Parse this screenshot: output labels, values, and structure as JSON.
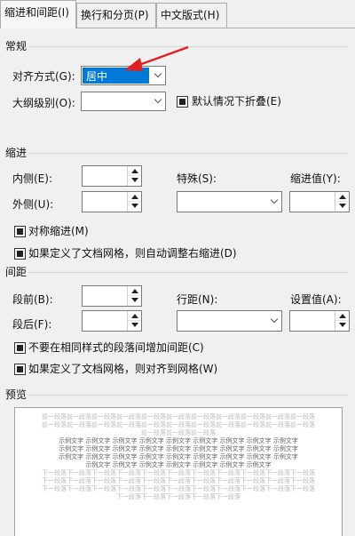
{
  "tabs": [
    {
      "label": "缩进和间距(I)",
      "active": true
    },
    {
      "label": "换行和分页(P)",
      "active": false
    },
    {
      "label": "中文版式(H)",
      "active": false
    }
  ],
  "general": {
    "title": "常规",
    "alignment_label": "对齐方式(G):",
    "alignment_value": "居中",
    "outline_label": "大纲级别(O):",
    "outline_value": "",
    "collapse_label": "默认情况下折叠(E)"
  },
  "indent": {
    "title": "缩进",
    "inside_label": "内侧(E):",
    "inside_value": "",
    "outside_label": "外侧(U):",
    "outside_value": "",
    "special_label": "特殊(S):",
    "special_value": "",
    "by_label": "缩进值(Y):",
    "by_value": "",
    "mirror_label": "对称缩进(M)",
    "grid_label": "如果定义了文档网格，则自动调整右缩进(D)"
  },
  "spacing": {
    "title": "间距",
    "before_label": "段前(B):",
    "before_value": "",
    "after_label": "段后(F):",
    "after_value": "",
    "line_label": "行距(N):",
    "line_value": "",
    "at_label": "设置值(A):",
    "at_value": "",
    "no_space_label": "不要在相同样式的段落间增加间距(C)",
    "snap_label": "如果定义了文档网格，则对齐到网格(W)"
  },
  "preview": {
    "title": "预览",
    "lines": [
      {
        "text": "前一段落前一段落前一段落前一段落前一段落前一段落前一段落前一段落前一段落前一段落前一段落",
        "tone": "grey"
      },
      {
        "text": "前一段落前一段落前一段落前一段落前一段落前一段落前一段落前一段落前一段落前一段落前一段落",
        "tone": "grey"
      },
      {
        "text": "前一段落前一段落前一段落",
        "tone": "grey"
      },
      {
        "text": "示例文字  示例文字  示例文字  示例文字  示例文字  示例文字  示例文字  示例文字  示例文字",
        "tone": "dark"
      },
      {
        "text": "示例文字  示例文字  示例文字  示例文字  示例文字  示例文字  示例文字  示例文字  示例文字",
        "tone": "dark"
      },
      {
        "text": "示例文字  示例文字  示例文字  示例文字  示例文字  示例文字  示例文字  示例文字  示例文字",
        "tone": "dark"
      },
      {
        "text": "示例文字  示例文字  示例文字  示例文字  示例文字  示例文字  示例文字",
        "tone": "dark"
      },
      {
        "text": "下一段落下一段落下一段落下一段落下一段落下一段落下一段落下一段落下一段落下一段落下一段落",
        "tone": "grey"
      },
      {
        "text": "下一段落下一段落下一段落下一段落下一段落下一段落下一段落下一段落下一段落下一段落下一段落",
        "tone": "grey"
      },
      {
        "text": "下一段落下一段落下一段落下一段落下一段落下一段落下一段落下一段落下一段落下一段落下一段落",
        "tone": "grey"
      },
      {
        "text": "下一段落下一段落下一段落下一段落下一段落",
        "tone": "grey"
      }
    ]
  },
  "annotation": {
    "type": "red-arrow",
    "color": "#e02020",
    "points_to": "alignment-combo"
  },
  "colors": {
    "selection": "#0078d7",
    "dialog_bg": "#f0f0f0"
  }
}
